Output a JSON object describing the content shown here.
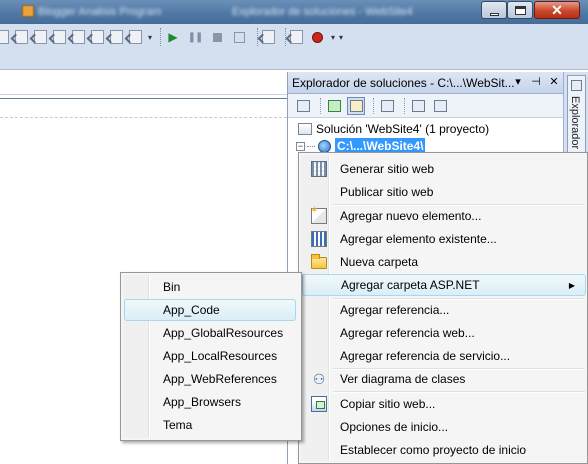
{
  "window": {
    "title_blurred": "Blogger Analisis Program",
    "title_blurred_2": "Explorador de soluciones - WebSite4",
    "buttons": {
      "minimize": "minimize-icon",
      "maximize": "maximize-icon",
      "close": "✕"
    }
  },
  "toolbar": {
    "icons": [
      "outdent-icon",
      "indent-icon",
      "comment-icon",
      "uncomment-icon",
      "bookmark-icon",
      "bookmark-prev-icon",
      "bookmark-next-icon",
      "find-icon",
      "play-icon",
      "pause-icon",
      "stop-icon",
      "step-icon",
      "window-icon",
      "breakpoint-icon"
    ],
    "overflow": "▾"
  },
  "solution_explorer": {
    "title": "Explorador de soluciones - C:\\...\\WebSit...",
    "title_buttons": {
      "dropdown": "▾",
      "pin": "⊣",
      "close": "✕"
    },
    "toolbar_icons": [
      "properties-icon",
      "refresh-icon",
      "nest-files-icon",
      "class-view-icon",
      "copy-website-icon",
      "asp-config-icon"
    ],
    "tree": {
      "solution": "Solución 'WebSite4'  (1 proyecto)",
      "expander": "−",
      "project": "C:\\...\\WebSite4\\"
    },
    "side_tab": "Explorador"
  },
  "context_menu": {
    "items": [
      {
        "label": "Generar sitio web",
        "icon": "build-website-icon"
      },
      {
        "label": "Publicar sitio web",
        "icon": ""
      },
      {
        "label": "Agregar nuevo elemento...",
        "icon": "new-item-icon"
      },
      {
        "label": "Agregar elemento existente...",
        "icon": "existing-item-icon"
      },
      {
        "label": "Nueva carpeta",
        "icon": "new-folder-icon"
      },
      {
        "label": "Agregar carpeta ASP.NET",
        "icon": "",
        "submenu_arrow": "▶"
      },
      {
        "label": "Agregar referencia...",
        "icon": ""
      },
      {
        "label": "Agregar referencia web...",
        "icon": ""
      },
      {
        "label": "Agregar referencia de servicio...",
        "icon": ""
      },
      {
        "label": "Ver diagrama de clases",
        "icon": "class-diagram-icon"
      },
      {
        "label": "Copiar sitio web...",
        "icon": "copy-website-icon"
      },
      {
        "label": "Opciones de inicio...",
        "icon": ""
      },
      {
        "label": "Establecer como proyecto de inicio",
        "icon": ""
      }
    ]
  },
  "submenu": {
    "items": [
      {
        "label": "Bin"
      },
      {
        "label": "App_Code"
      },
      {
        "label": "App_GlobalResources"
      },
      {
        "label": "App_LocalResources"
      },
      {
        "label": "App_WebReferences"
      },
      {
        "label": "App_Browsers"
      },
      {
        "label": "Tema"
      }
    ],
    "highlighted": "App_Code"
  },
  "colors": {
    "title_bar": "#4f77a4",
    "toolbar": "#d4dff0",
    "selection": "#3399ff",
    "menu_highlight": "#dbeef7"
  }
}
